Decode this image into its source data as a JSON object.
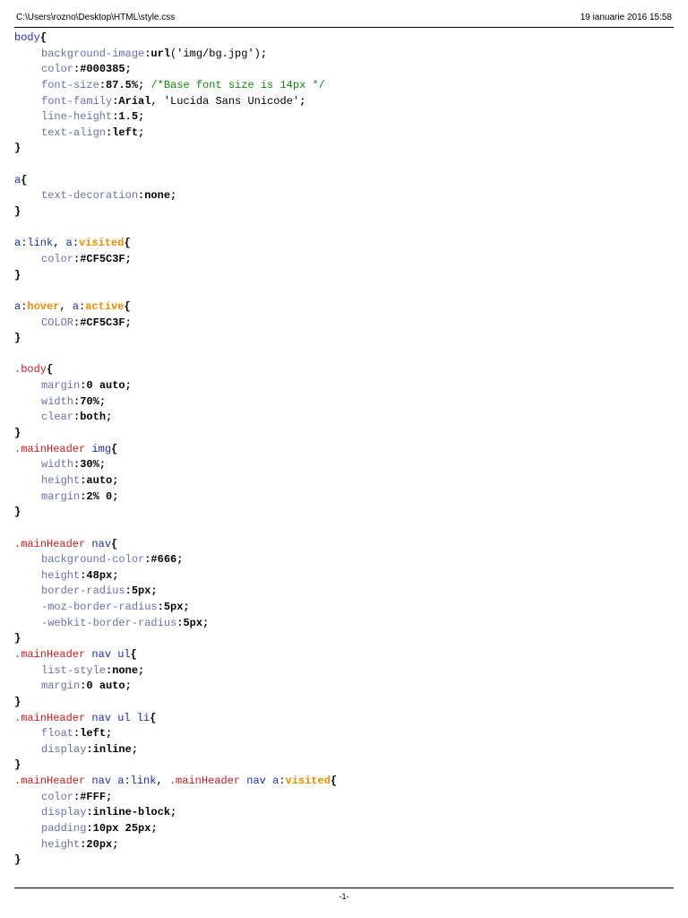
{
  "header": {
    "path": "C:\\Users\\rozno\\Desktop\\HTML\\style.css",
    "date": "19 ianuarie 2016 15:58"
  },
  "footer": {
    "page": "-1-"
  },
  "colors": {
    "selector": "#1d2bb8",
    "class_selector": "#cc1b1b",
    "pseudo_class": "#f08a00",
    "property": "#6d6db5",
    "comment": "#0a8a0a"
  },
  "code": [
    [
      {
        "t": "sel",
        "v": "body"
      },
      {
        "t": "pun",
        "v": "{"
      }
    ],
    [
      {
        "t": "ind"
      },
      {
        "t": "prop",
        "v": "background-image"
      },
      {
        "t": "pun",
        "v": ":"
      },
      {
        "t": "val",
        "v": "url"
      },
      {
        "t": "str",
        "v": "('img/bg.jpg')"
      },
      {
        "t": "pun",
        "v": ";"
      }
    ],
    [
      {
        "t": "ind"
      },
      {
        "t": "prop",
        "v": "color"
      },
      {
        "t": "pun",
        "v": ":"
      },
      {
        "t": "val",
        "v": "#000385"
      },
      {
        "t": "pun",
        "v": ";"
      }
    ],
    [
      {
        "t": "ind"
      },
      {
        "t": "prop",
        "v": "font-size"
      },
      {
        "t": "pun",
        "v": ":"
      },
      {
        "t": "val",
        "v": "87.5%"
      },
      {
        "t": "pun",
        "v": "; "
      },
      {
        "t": "cmt",
        "v": "/*Base font size is 14px */"
      }
    ],
    [
      {
        "t": "ind"
      },
      {
        "t": "prop",
        "v": "font-family"
      },
      {
        "t": "pun",
        "v": ":"
      },
      {
        "t": "val",
        "v": "Arial"
      },
      {
        "t": "str",
        "v": ", 'Lucida Sans Unicode'"
      },
      {
        "t": "pun",
        "v": ";"
      }
    ],
    [
      {
        "t": "ind"
      },
      {
        "t": "prop",
        "v": "line-height"
      },
      {
        "t": "pun",
        "v": ":"
      },
      {
        "t": "val",
        "v": "1.5"
      },
      {
        "t": "pun",
        "v": ";"
      }
    ],
    [
      {
        "t": "ind"
      },
      {
        "t": "prop",
        "v": "text-align"
      },
      {
        "t": "pun",
        "v": ":"
      },
      {
        "t": "val",
        "v": "left"
      },
      {
        "t": "pun",
        "v": ";"
      }
    ],
    [
      {
        "t": "pun",
        "v": "}"
      }
    ],
    [],
    [
      {
        "t": "sel",
        "v": "a"
      },
      {
        "t": "pun",
        "v": "{"
      }
    ],
    [
      {
        "t": "ind"
      },
      {
        "t": "prop",
        "v": "text-decoration"
      },
      {
        "t": "pun",
        "v": ":"
      },
      {
        "t": "val",
        "v": "none"
      },
      {
        "t": "pun",
        "v": ";"
      }
    ],
    [
      {
        "t": "pun",
        "v": "}"
      }
    ],
    [],
    [
      {
        "t": "sel",
        "v": "a"
      },
      {
        "t": "str",
        "v": ":"
      },
      {
        "t": "sel",
        "v": "link"
      },
      {
        "t": "str",
        "v": ", "
      },
      {
        "t": "sel",
        "v": "a"
      },
      {
        "t": "str",
        "v": ":"
      },
      {
        "t": "pseudo",
        "v": "visited"
      },
      {
        "t": "pun",
        "v": "{"
      }
    ],
    [
      {
        "t": "ind"
      },
      {
        "t": "prop",
        "v": "color"
      },
      {
        "t": "pun",
        "v": ":"
      },
      {
        "t": "val",
        "v": "#CF5C3F"
      },
      {
        "t": "pun",
        "v": ";"
      }
    ],
    [
      {
        "t": "pun",
        "v": "}"
      }
    ],
    [],
    [
      {
        "t": "sel",
        "v": "a"
      },
      {
        "t": "str",
        "v": ":"
      },
      {
        "t": "pseudo",
        "v": "hover"
      },
      {
        "t": "str",
        "v": ", "
      },
      {
        "t": "sel",
        "v": "a"
      },
      {
        "t": "str",
        "v": ":"
      },
      {
        "t": "pseudo",
        "v": "active"
      },
      {
        "t": "pun",
        "v": "{"
      }
    ],
    [
      {
        "t": "ind"
      },
      {
        "t": "prop",
        "v": "COLOR"
      },
      {
        "t": "pun",
        "v": ":"
      },
      {
        "t": "val",
        "v": "#CF5C3F"
      },
      {
        "t": "pun",
        "v": ";"
      }
    ],
    [
      {
        "t": "pun",
        "v": "}"
      }
    ],
    [],
    [
      {
        "t": "cls",
        "v": ".body"
      },
      {
        "t": "pun",
        "v": "{"
      }
    ],
    [
      {
        "t": "ind"
      },
      {
        "t": "prop",
        "v": "margin"
      },
      {
        "t": "pun",
        "v": ":"
      },
      {
        "t": "val",
        "v": "0 auto"
      },
      {
        "t": "pun",
        "v": ";"
      }
    ],
    [
      {
        "t": "ind"
      },
      {
        "t": "prop",
        "v": "width"
      },
      {
        "t": "pun",
        "v": ":"
      },
      {
        "t": "val",
        "v": "70%"
      },
      {
        "t": "pun",
        "v": ";"
      }
    ],
    [
      {
        "t": "ind"
      },
      {
        "t": "prop",
        "v": "clear"
      },
      {
        "t": "pun",
        "v": ":"
      },
      {
        "t": "val",
        "v": "both"
      },
      {
        "t": "pun",
        "v": ";"
      }
    ],
    [
      {
        "t": "pun",
        "v": "}"
      }
    ],
    [
      {
        "t": "cls",
        "v": ".mainHeader "
      },
      {
        "t": "sel",
        "v": "img"
      },
      {
        "t": "pun",
        "v": "{"
      }
    ],
    [
      {
        "t": "ind"
      },
      {
        "t": "prop",
        "v": "width"
      },
      {
        "t": "pun",
        "v": ":"
      },
      {
        "t": "val",
        "v": "30%"
      },
      {
        "t": "pun",
        "v": ";"
      }
    ],
    [
      {
        "t": "ind"
      },
      {
        "t": "prop",
        "v": "height"
      },
      {
        "t": "pun",
        "v": ":"
      },
      {
        "t": "val",
        "v": "auto"
      },
      {
        "t": "pun",
        "v": ";"
      }
    ],
    [
      {
        "t": "ind"
      },
      {
        "t": "prop",
        "v": "margin"
      },
      {
        "t": "pun",
        "v": ":"
      },
      {
        "t": "val",
        "v": "2% 0"
      },
      {
        "t": "pun",
        "v": ";"
      }
    ],
    [
      {
        "t": "pun",
        "v": "}"
      }
    ],
    [],
    [
      {
        "t": "cls",
        "v": ".mainHeader "
      },
      {
        "t": "sel",
        "v": "nav"
      },
      {
        "t": "pun",
        "v": "{"
      }
    ],
    [
      {
        "t": "ind"
      },
      {
        "t": "prop",
        "v": "background-color"
      },
      {
        "t": "pun",
        "v": ":"
      },
      {
        "t": "val",
        "v": "#666"
      },
      {
        "t": "pun",
        "v": ";"
      }
    ],
    [
      {
        "t": "ind"
      },
      {
        "t": "prop",
        "v": "height"
      },
      {
        "t": "pun",
        "v": ":"
      },
      {
        "t": "val",
        "v": "48px"
      },
      {
        "t": "pun",
        "v": ";"
      }
    ],
    [
      {
        "t": "ind"
      },
      {
        "t": "prop",
        "v": "border-radius"
      },
      {
        "t": "pun",
        "v": ":"
      },
      {
        "t": "val",
        "v": "5px"
      },
      {
        "t": "pun",
        "v": ";"
      }
    ],
    [
      {
        "t": "ind"
      },
      {
        "t": "prop",
        "v": "-moz-border-radius"
      },
      {
        "t": "pun",
        "v": ":"
      },
      {
        "t": "val",
        "v": "5px"
      },
      {
        "t": "pun",
        "v": ";"
      }
    ],
    [
      {
        "t": "ind"
      },
      {
        "t": "prop",
        "v": "-webkit-border-radius"
      },
      {
        "t": "pun",
        "v": ":"
      },
      {
        "t": "val",
        "v": "5px"
      },
      {
        "t": "pun",
        "v": ";"
      }
    ],
    [
      {
        "t": "pun",
        "v": "}"
      }
    ],
    [
      {
        "t": "cls",
        "v": ".mainHeader "
      },
      {
        "t": "sel",
        "v": "nav ul"
      },
      {
        "t": "pun",
        "v": "{"
      }
    ],
    [
      {
        "t": "ind"
      },
      {
        "t": "prop",
        "v": "list-style"
      },
      {
        "t": "pun",
        "v": ":"
      },
      {
        "t": "val",
        "v": "none"
      },
      {
        "t": "pun",
        "v": ";"
      }
    ],
    [
      {
        "t": "ind"
      },
      {
        "t": "prop",
        "v": "margin"
      },
      {
        "t": "pun",
        "v": ":"
      },
      {
        "t": "val",
        "v": "0 auto"
      },
      {
        "t": "pun",
        "v": ";"
      }
    ],
    [
      {
        "t": "pun",
        "v": "}"
      }
    ],
    [
      {
        "t": "cls",
        "v": ".mainHeader "
      },
      {
        "t": "sel",
        "v": "nav ul li"
      },
      {
        "t": "pun",
        "v": "{"
      }
    ],
    [
      {
        "t": "ind"
      },
      {
        "t": "prop",
        "v": "float"
      },
      {
        "t": "pun",
        "v": ":"
      },
      {
        "t": "val",
        "v": "left"
      },
      {
        "t": "pun",
        "v": ";"
      }
    ],
    [
      {
        "t": "ind"
      },
      {
        "t": "prop",
        "v": "display"
      },
      {
        "t": "pun",
        "v": ":"
      },
      {
        "t": "val",
        "v": "inline"
      },
      {
        "t": "pun",
        "v": ";"
      }
    ],
    [
      {
        "t": "pun",
        "v": "}"
      }
    ],
    [
      {
        "t": "cls",
        "v": ".mainHeader "
      },
      {
        "t": "sel",
        "v": "nav a"
      },
      {
        "t": "str",
        "v": ":"
      },
      {
        "t": "sel",
        "v": "link"
      },
      {
        "t": "str",
        "v": ", "
      },
      {
        "t": "cls",
        "v": ".mainHeader "
      },
      {
        "t": "sel",
        "v": "nav a"
      },
      {
        "t": "str",
        "v": ":"
      },
      {
        "t": "pseudo",
        "v": "visited"
      },
      {
        "t": "pun",
        "v": "{"
      }
    ],
    [
      {
        "t": "ind"
      },
      {
        "t": "prop",
        "v": "color"
      },
      {
        "t": "pun",
        "v": ":"
      },
      {
        "t": "val",
        "v": "#FFF"
      },
      {
        "t": "pun",
        "v": ";"
      }
    ],
    [
      {
        "t": "ind"
      },
      {
        "t": "prop",
        "v": "display"
      },
      {
        "t": "pun",
        "v": ":"
      },
      {
        "t": "val",
        "v": "inline-block"
      },
      {
        "t": "pun",
        "v": ";"
      }
    ],
    [
      {
        "t": "ind"
      },
      {
        "t": "prop",
        "v": "padding"
      },
      {
        "t": "pun",
        "v": ":"
      },
      {
        "t": "val",
        "v": "10px 25px"
      },
      {
        "t": "pun",
        "v": ";"
      }
    ],
    [
      {
        "t": "ind"
      },
      {
        "t": "prop",
        "v": "height"
      },
      {
        "t": "pun",
        "v": ":"
      },
      {
        "t": "val",
        "v": "20px"
      },
      {
        "t": "pun",
        "v": ";"
      }
    ],
    [
      {
        "t": "pun",
        "v": "}"
      }
    ]
  ]
}
